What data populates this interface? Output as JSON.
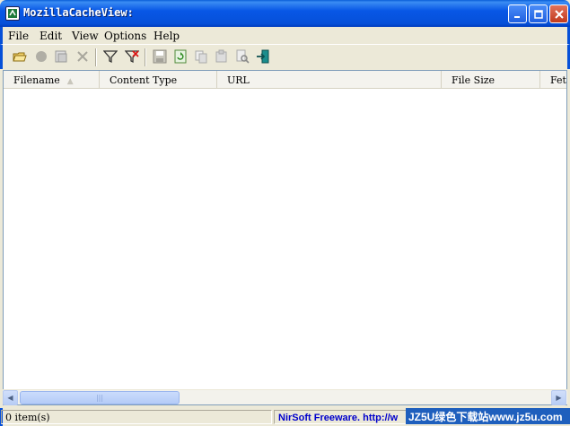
{
  "window": {
    "title": "MozillaCacheView:"
  },
  "menu": [
    "File",
    "Edit",
    "View",
    "Options",
    "Help"
  ],
  "columns": [
    "Filename",
    "Content Type",
    "URL",
    "File Size",
    "Fetc"
  ],
  "status": {
    "items": "0 item(s)",
    "link": "NirSoft Freeware.  http://w"
  },
  "watermark": "JZ5U绿色下载站www.jz5u.com",
  "colors": {
    "titlebar": "#0650d8",
    "frame": "#ece9d8",
    "link": "#0000cc"
  }
}
